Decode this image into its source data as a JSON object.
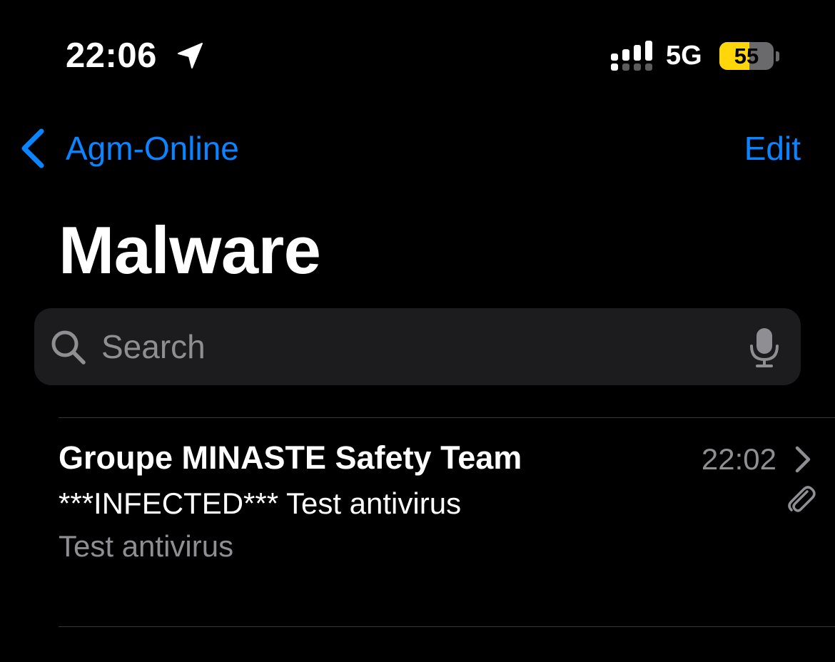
{
  "status_bar": {
    "time": "22:06",
    "network": "5G",
    "battery_percent": 55,
    "battery_label": "55",
    "signal_bars_active": 3,
    "signal_bars_total": 4,
    "icons": {
      "location": "location-arrow-icon",
      "signal": "cellular-signal-icon",
      "battery": "battery-icon"
    }
  },
  "nav": {
    "back_label": "Agm-Online",
    "edit_label": "Edit"
  },
  "page": {
    "title": "Malware"
  },
  "search": {
    "placeholder": "Search",
    "value": ""
  },
  "messages": [
    {
      "sender": "Groupe MINASTE Safety Team",
      "time": "22:02",
      "subject": "***INFECTED*** Test antivirus",
      "preview": "Test antivirus",
      "has_attachment": true
    }
  ],
  "colors": {
    "background": "#000000",
    "accent": "#0a84ff",
    "secondary_text": "#8e8e93",
    "search_field": "#1c1c1e",
    "separator": "#38383a",
    "battery_fill": "#ffd60a"
  }
}
